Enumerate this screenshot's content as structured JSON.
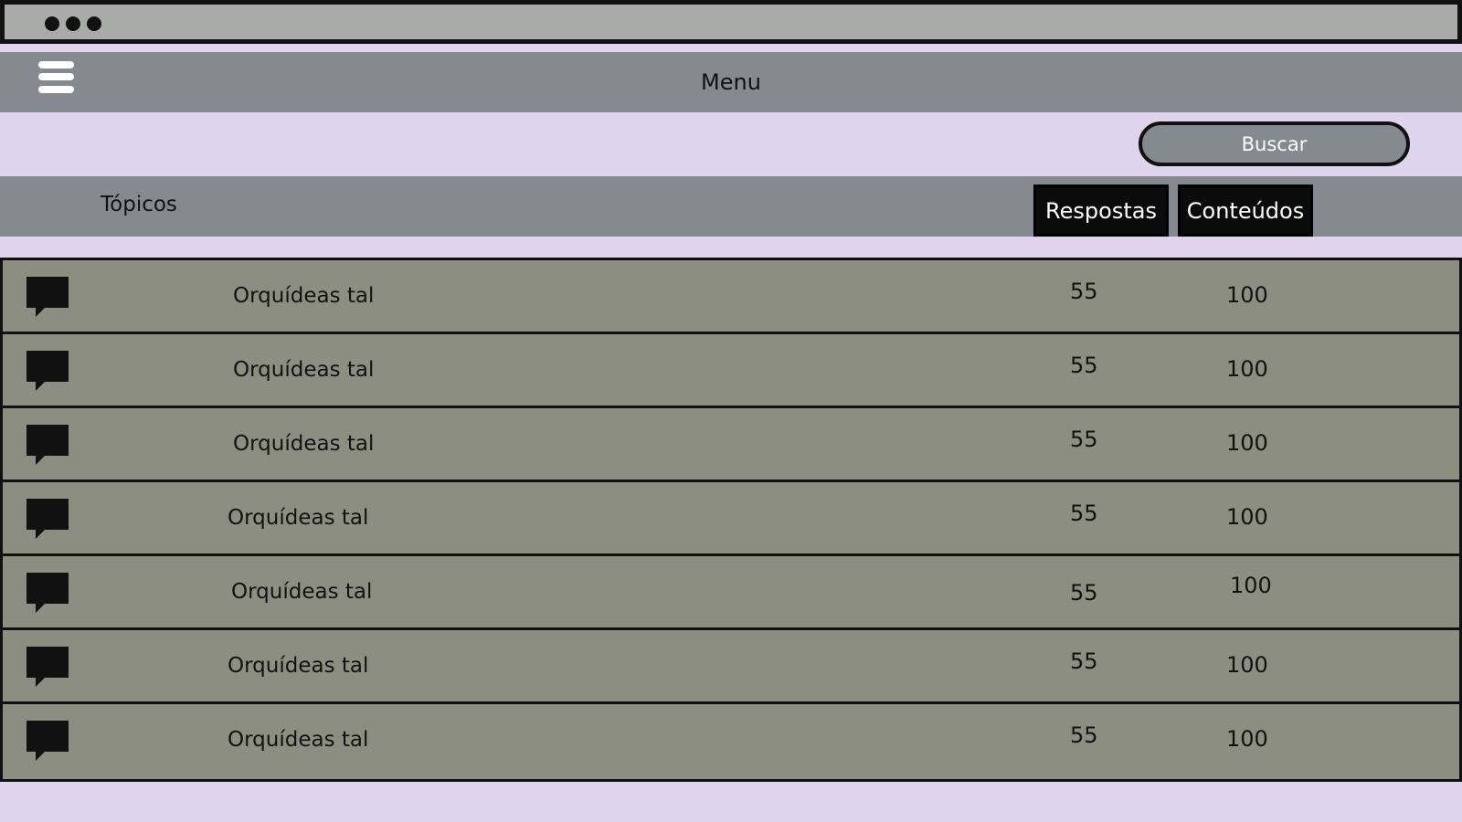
{
  "window": {
    "dots": [
      "dot",
      "dot",
      "dot"
    ]
  },
  "menubar": {
    "title": "Menu",
    "menu_icon": "hamburger-icon"
  },
  "search": {
    "label": "Buscar"
  },
  "topics": {
    "title": "Tópicos",
    "tabs": [
      {
        "label": "Respostas"
      },
      {
        "label": "Conteúdos"
      }
    ]
  },
  "rows": [
    {
      "icon": "chat-bubble-icon",
      "title": "Orquídeas tal",
      "replies": "55",
      "contents": "100"
    },
    {
      "icon": "chat-bubble-icon",
      "title": "Orquídeas tal",
      "replies": "55",
      "contents": "100"
    },
    {
      "icon": "chat-bubble-icon",
      "title": "Orquídeas tal",
      "replies": "55",
      "contents": "100"
    },
    {
      "icon": "chat-bubble-icon",
      "title": "Orquídeas tal",
      "replies": "55",
      "contents": "100"
    },
    {
      "icon": "chat-bubble-icon",
      "title": "Orquídeas tal",
      "replies": "55",
      "contents": "100"
    },
    {
      "icon": "chat-bubble-icon",
      "title": "Orquídeas tal",
      "replies": "55",
      "contents": "100"
    },
    {
      "icon": "chat-bubble-icon",
      "title": "Orquídeas tal",
      "replies": "55",
      "contents": "100"
    }
  ],
  "colors": {
    "background": "#e0d3ee",
    "bar": "#858a91",
    "row": "#8d8e82",
    "dark": "#0b0b0b"
  }
}
